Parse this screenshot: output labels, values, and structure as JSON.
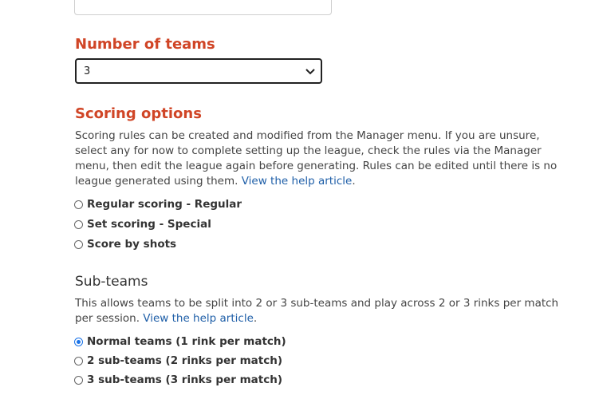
{
  "teams": {
    "heading": "Number of teams",
    "selected": "3"
  },
  "scoring": {
    "heading": "Scoring options",
    "description": "Scoring rules can be created and modified from the Manager menu. If you are unsure, select any for now to complete setting up the league, check the rules via the Manager menu, then edit the league again before generating. Rules can be edited until there is no league generated using them.",
    "help_link": "View the help article",
    "options": [
      {
        "label": "Regular scoring - Regular",
        "checked": false
      },
      {
        "label": "Set scoring - Special",
        "checked": false
      },
      {
        "label": "Score by shots",
        "checked": false
      }
    ]
  },
  "subteams": {
    "heading": "Sub-teams",
    "description": "This allows teams to be split into 2 or 3 sub-teams and play across 2 or 3 rinks per match per session.",
    "help_link": "View the help article",
    "options": [
      {
        "label": "Normal teams (1 rink per match)",
        "checked": true
      },
      {
        "label": "2 sub-teams (2 rinks per match)",
        "checked": false
      },
      {
        "label": "3 sub-teams (3 rinks per match)",
        "checked": false
      }
    ]
  }
}
